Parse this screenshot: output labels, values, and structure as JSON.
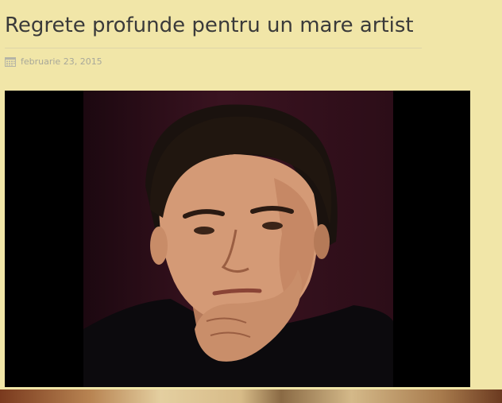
{
  "post": {
    "title": "Regrete profunde pentru un mare artist",
    "date": "februarie 23, 2015",
    "date_icon": "calendar-icon",
    "featured_image": {
      "subject": "portrait-photo"
    }
  },
  "colors": {
    "page_background": "#f1e6a8",
    "title_text": "#3a3a3a",
    "meta_text": "#a8a89a",
    "image_background": "#000000"
  }
}
